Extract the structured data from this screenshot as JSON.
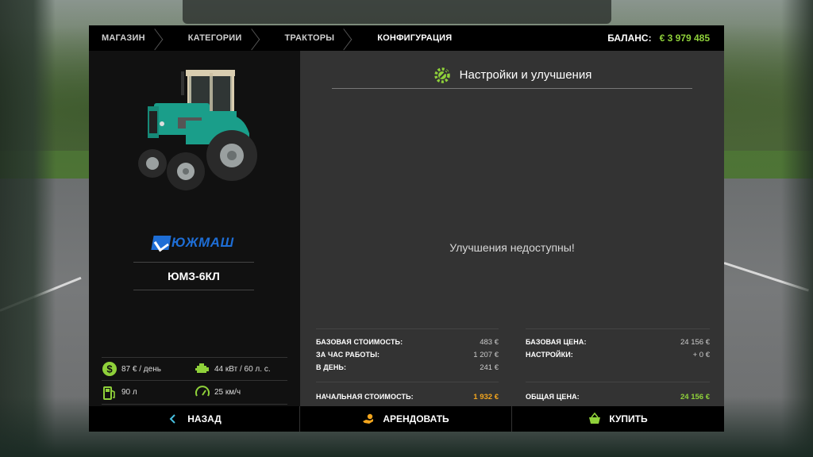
{
  "breadcrumb": {
    "items": [
      "МАГАЗИН",
      "КАТЕГОРИИ",
      "ТРАКТОРЫ",
      "КОНФИГУРАЦИЯ"
    ]
  },
  "balance": {
    "label": "БАЛАНС:",
    "value": "€ 3 979 485"
  },
  "vehicle": {
    "brand": "ЮЖМАШ",
    "model": "ЮМЗ-6КЛ",
    "specs": [
      {
        "icon": "money-icon",
        "text": "87 € / день"
      },
      {
        "icon": "engine-icon",
        "text": "44 кВт / 60 л. с."
      },
      {
        "icon": "fuel-icon",
        "text": "90 л"
      },
      {
        "icon": "speedometer-icon",
        "text": "25 км/ч"
      }
    ]
  },
  "upgrades": {
    "title": "Настройки и улучшения",
    "empty_message": "Улучшения недоступны!"
  },
  "costs": {
    "lease": {
      "base_label": "БАЗОВАЯ СТОИМОСТЬ:",
      "base_value": "483 €",
      "per_hour_label": "ЗА ЧАС РАБОТЫ:",
      "per_hour_value": "1 207 €",
      "per_day_label": "В ДЕНЬ:",
      "per_day_value": "241 €",
      "initial_label": "НАЧАЛЬНАЯ СТОИМОСТЬ:",
      "initial_value": "1 932 €"
    },
    "purchase": {
      "base_label": "БАЗОВАЯ ЦЕНА:",
      "base_value": "24 156 €",
      "config_label": "НАСТРОЙКИ:",
      "config_value": "+ 0 €",
      "total_label": "ОБЩАЯ ЦЕНА:",
      "total_value": "24 156 €"
    }
  },
  "actions": {
    "back": "НАЗАД",
    "lease": "АРЕНДОВАТЬ",
    "buy": "КУПИТЬ"
  },
  "colors": {
    "accent_green": "#8fd13a",
    "accent_orange": "#f3a51d",
    "brand_blue": "#1e6ed6",
    "tractor_teal": "#1a9e8a"
  }
}
